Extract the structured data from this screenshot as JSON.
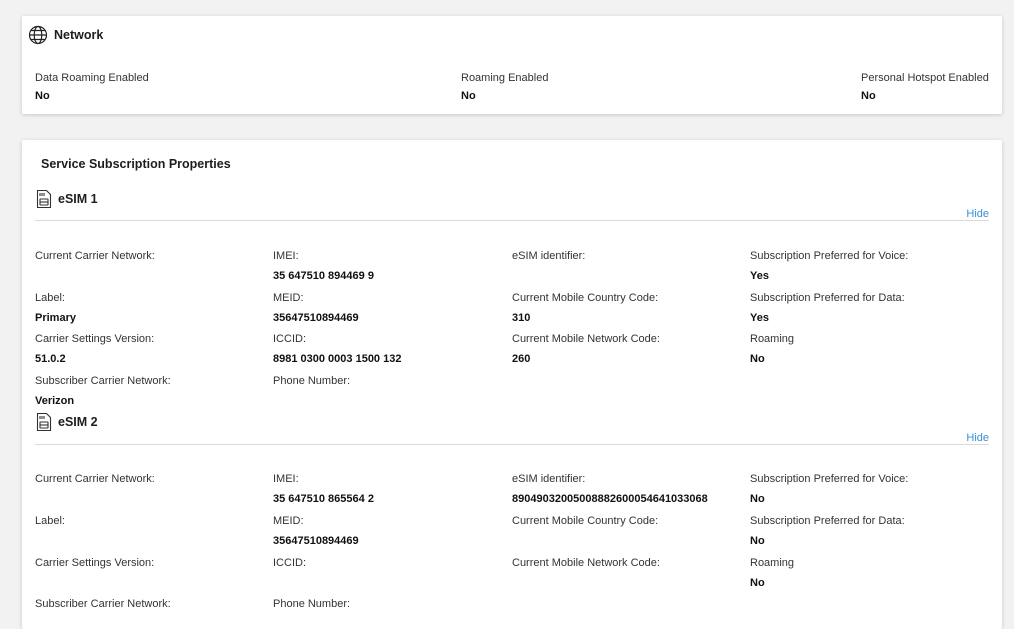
{
  "network": {
    "title": "Network",
    "icon": "globe-icon",
    "fields": [
      {
        "label": "Data Roaming Enabled",
        "value": "No"
      },
      {
        "label": "Roaming Enabled",
        "value": "No"
      },
      {
        "label": "Personal Hotspot Enabled",
        "value": "No"
      }
    ]
  },
  "service": {
    "title": "Service Subscription Properties",
    "esims": [
      {
        "title": "eSIM 1",
        "icon": "sim-card-icon",
        "hide_label": "Hide",
        "fields": {
          "current_carrier_network": {
            "label": "Current Carrier Network:",
            "value": ""
          },
          "label": {
            "label": "Label:",
            "value": "Primary"
          },
          "carrier_settings_version": {
            "label": "Carrier Settings Version:",
            "value": "51.0.2"
          },
          "subscriber_carrier_network": {
            "label": "Subscriber Carrier Network:",
            "value": "Verizon"
          },
          "imei": {
            "label": "IMEI:",
            "value": "35 647510 894469 9"
          },
          "meid": {
            "label": "MEID:",
            "value": "35647510894469"
          },
          "iccid": {
            "label": "ICCID:",
            "value": "8981 0300 0003 1500 132"
          },
          "phone_number": {
            "label": "Phone Number:",
            "value": ""
          },
          "esim_identifier": {
            "label": "eSIM identifier:",
            "value": ""
          },
          "mobile_country_code": {
            "label": "Current Mobile Country Code:",
            "value": "310"
          },
          "mobile_network_code": {
            "label": "Current Mobile Network Code:",
            "value": "260"
          },
          "preferred_voice": {
            "label": "Subscription Preferred for Voice:",
            "value": "Yes"
          },
          "preferred_data": {
            "label": "Subscription Preferred for Data:",
            "value": "Yes"
          },
          "roaming": {
            "label": "Roaming",
            "value": "No"
          }
        }
      },
      {
        "title": "eSIM 2",
        "icon": "sim-card-icon",
        "hide_label": "Hide",
        "fields": {
          "current_carrier_network": {
            "label": "Current Carrier Network:",
            "value": ""
          },
          "label": {
            "label": "Label:",
            "value": ""
          },
          "carrier_settings_version": {
            "label": "Carrier Settings Version:",
            "value": ""
          },
          "subscriber_carrier_network": {
            "label": "Subscriber Carrier Network:",
            "value": ""
          },
          "imei": {
            "label": "IMEI:",
            "value": "35 647510 865564 2"
          },
          "meid": {
            "label": "MEID:",
            "value": "35647510894469"
          },
          "iccid": {
            "label": "ICCID:",
            "value": ""
          },
          "phone_number": {
            "label": "Phone Number:",
            "value": ""
          },
          "esim_identifier": {
            "label": "eSIM identifier:",
            "value": "89049032005008882600054641033068"
          },
          "mobile_country_code": {
            "label": "Current Mobile Country Code:",
            "value": ""
          },
          "mobile_network_code": {
            "label": "Current Mobile Network Code:",
            "value": ""
          },
          "preferred_voice": {
            "label": "Subscription Preferred for Voice:",
            "value": "No"
          },
          "preferred_data": {
            "label": "Subscription Preferred for Data:",
            "value": "No"
          },
          "roaming": {
            "label": "Roaming",
            "value": "No"
          }
        }
      }
    ]
  },
  "colors": {
    "link": "#3b8fd6",
    "divider": "#d9d9d9"
  }
}
